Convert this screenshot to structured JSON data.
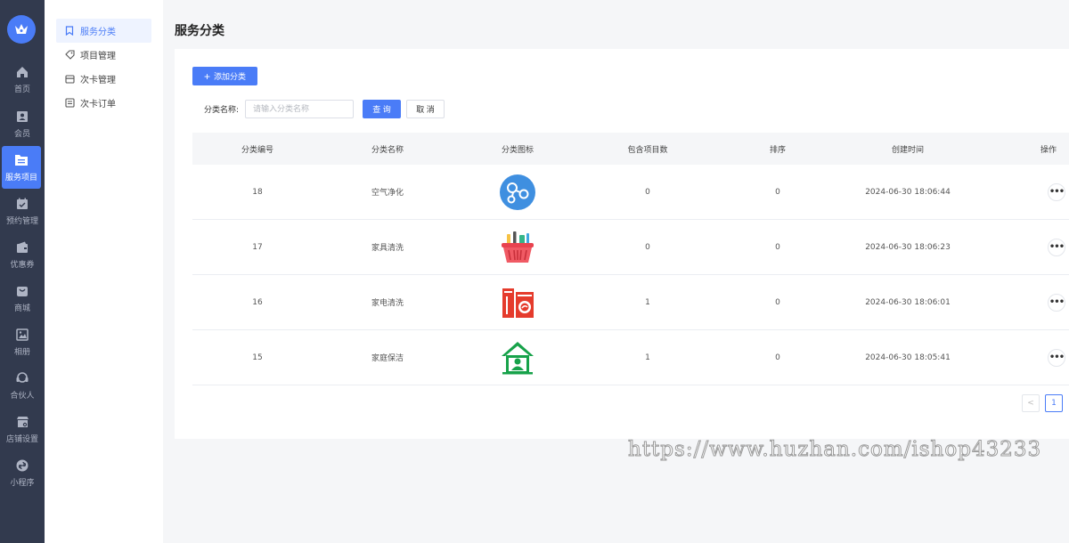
{
  "rail": {
    "items": [
      {
        "label": "首页",
        "icon": "home-icon"
      },
      {
        "label": "会员",
        "icon": "member-icon"
      },
      {
        "label": "服务项目",
        "icon": "service-icon"
      },
      {
        "label": "预约管理",
        "icon": "calendar-icon"
      },
      {
        "label": "优惠券",
        "icon": "coupon-icon"
      },
      {
        "label": "商城",
        "icon": "mall-icon"
      },
      {
        "label": "相册",
        "icon": "album-icon"
      },
      {
        "label": "合伙人",
        "icon": "partner-icon"
      },
      {
        "label": "店铺设置",
        "icon": "store-icon"
      },
      {
        "label": "小程序",
        "icon": "miniprogram-icon"
      }
    ]
  },
  "subnav": {
    "items": [
      {
        "label": "服务分类",
        "icon": "bookmark-icon"
      },
      {
        "label": "项目管理",
        "icon": "tag-icon"
      },
      {
        "label": "次卡管理",
        "icon": "card-icon"
      },
      {
        "label": "次卡订单",
        "icon": "order-icon"
      }
    ]
  },
  "page": {
    "title": "服务分类",
    "add_button": "添加分类",
    "filter_label": "分类名称:",
    "filter_placeholder": "请输入分类名称",
    "query_button": "查 询",
    "cancel_button": "取 消"
  },
  "table": {
    "headers": [
      "分类编号",
      "分类名称",
      "分类图标",
      "包含项目数",
      "排序",
      "创建时间",
      "操作"
    ],
    "rows": [
      {
        "id": "18",
        "name": "空气净化",
        "icon": "air-purify-icon",
        "count": "0",
        "sort": "0",
        "created": "2024-06-30 18:06:44"
      },
      {
        "id": "17",
        "name": "家具清洗",
        "icon": "basket-icon",
        "count": "0",
        "sort": "0",
        "created": "2024-06-30 18:06:23"
      },
      {
        "id": "16",
        "name": "家电清洗",
        "icon": "appliance-icon",
        "count": "1",
        "sort": "0",
        "created": "2024-06-30 18:06:01"
      },
      {
        "id": "15",
        "name": "家庭保洁",
        "icon": "house-icon",
        "count": "1",
        "sort": "0",
        "created": "2024-06-30 18:05:41"
      }
    ],
    "action_label": "•••"
  },
  "pagination": {
    "prev": "<",
    "current": "1"
  },
  "watermark": "https://www.huzhan.com/ishop43233",
  "colors": {
    "accent": "#4a7cf7",
    "rail_bg": "#323a4e"
  }
}
